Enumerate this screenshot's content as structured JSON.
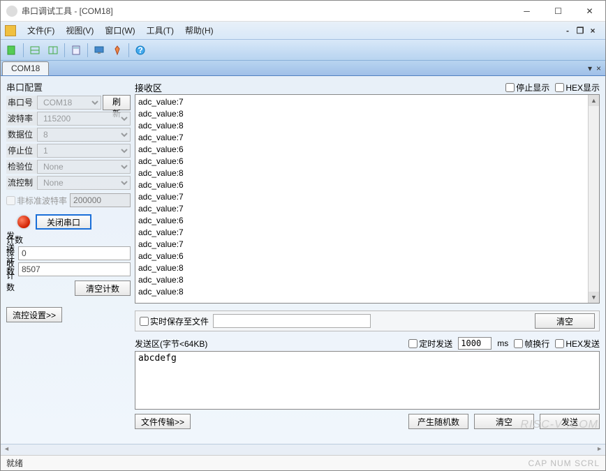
{
  "window": {
    "title": "串口调试工具 - [COM18]"
  },
  "menu": {
    "file": "文件(F)",
    "view": "视图(V)",
    "window": "窗口(W)",
    "tools": "工具(T)",
    "help": "帮助(H)"
  },
  "tab": {
    "name": "COM18"
  },
  "config": {
    "title": "串口配置",
    "port_label": "串口号",
    "port_value": "COM18",
    "refresh": "刷新",
    "baud_label": "波特率",
    "baud_value": "115200",
    "data_label": "数据位",
    "data_value": "8",
    "stop_label": "停止位",
    "stop_value": "1",
    "parity_label": "检验位",
    "parity_value": "None",
    "flow_label": "流控制",
    "flow_value": "None",
    "nonstd_label": "非标准波特率",
    "nonstd_value": "200000",
    "close_btn": "关闭串口",
    "count_title": "计数",
    "send_count_label": "发送计数",
    "send_count_value": "0",
    "recv_count_label": "接收计数",
    "recv_count_value": "8507",
    "clear_count": "清空计数",
    "flow_settings": "流控设置>>"
  },
  "rx": {
    "title": "接收区",
    "pause": "停止显示",
    "hex": "HEX显示",
    "lines": "adc_value:7\nadc_value:8\nadc_value:8\nadc_value:7\nadc_value:6\nadc_value:6\nadc_value:8\nadc_value:6\nadc_value:7\nadc_value:7\nadc_value:6\nadc_value:7\nadc_value:7\nadc_value:6\nadc_value:8\nadc_value:8\nadc_value:8"
  },
  "save": {
    "label": "实时保存至文件",
    "clear": "清空"
  },
  "tx": {
    "title": "发送区(字节<64KB)",
    "timed": "定时发送",
    "interval": "1000",
    "ms": "ms",
    "wrap": "帧换行",
    "hex": "HEX发送",
    "content": "abcdefg",
    "file_btn": "文件传输>>",
    "random_btn": "产生随机数",
    "clear_btn": "清空",
    "send_btn": "发送"
  },
  "status": {
    "ready": "就绪",
    "indicators": "CAP  NUM  SCRL"
  },
  "watermark": "RISC-V .COM"
}
